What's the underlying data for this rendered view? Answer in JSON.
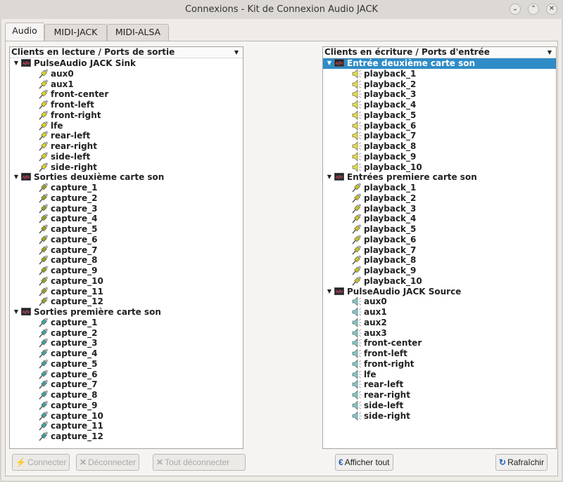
{
  "window": {
    "title": "Connexions - Kit de Connexion Audio JACK",
    "controls": [
      "minimize",
      "maximize",
      "close"
    ]
  },
  "tabs": [
    {
      "label": "Audio",
      "active": true
    },
    {
      "label": "MIDI-JACK"
    },
    {
      "label": "MIDI-ALSA"
    }
  ],
  "left": {
    "header": "Clients en lecture / Ports de sortie",
    "clients": [
      {
        "name": "PulseAudio JACK Sink",
        "color": "#e0d020",
        "ports": [
          "aux0",
          "aux1",
          "front-center",
          "front-left",
          "front-right",
          "lfe",
          "rear-left",
          "rear-right",
          "side-left",
          "side-right"
        ]
      },
      {
        "name": "Sorties deuxième carte son",
        "color": "#9aa020",
        "ports": [
          "capture_1",
          "capture_2",
          "capture_3",
          "capture_4",
          "capture_5",
          "capture_6",
          "capture_7",
          "capture_8",
          "capture_9",
          "capture_10",
          "capture_11",
          "capture_12"
        ]
      },
      {
        "name": "Sorties première carte son",
        "color": "#40a0a0",
        "ports": [
          "capture_1",
          "capture_2",
          "capture_3",
          "capture_4",
          "capture_5",
          "capture_6",
          "capture_7",
          "capture_8",
          "capture_9",
          "capture_10",
          "capture_11",
          "capture_12"
        ]
      }
    ]
  },
  "right": {
    "header": "Clients en écriture / Ports d'entrée",
    "clients": [
      {
        "name": "Entrée deuxième carte son",
        "selected": true,
        "icon": "speaker",
        "color": "#e8e040",
        "ports": [
          "playback_1",
          "playback_2",
          "playback_3",
          "playback_4",
          "playback_5",
          "playback_6",
          "playback_7",
          "playback_8",
          "playback_9",
          "playback_10"
        ]
      },
      {
        "name": "Entrées premiere carte son",
        "icon": "plug",
        "color": "#c8c020",
        "ports": [
          "playback_1",
          "playback_2",
          "playback_3",
          "playback_4",
          "playback_5",
          "playback_6",
          "playback_7",
          "playback_8",
          "playback_9",
          "playback_10"
        ]
      },
      {
        "name": "PulseAudio JACK Source",
        "icon": "speaker",
        "color": "#80c8c8",
        "ports": [
          "aux0",
          "aux1",
          "aux2",
          "aux3",
          "front-center",
          "front-left",
          "front-right",
          "lfe",
          "rear-left",
          "rear-right",
          "side-left",
          "side-right"
        ]
      }
    ]
  },
  "buttons": {
    "connect": "Connecter",
    "disconnect": "Déconnecter",
    "disconnect_all": "Tout déconnecter",
    "show_all": "Afficher tout",
    "refresh": "Rafraîchir"
  }
}
